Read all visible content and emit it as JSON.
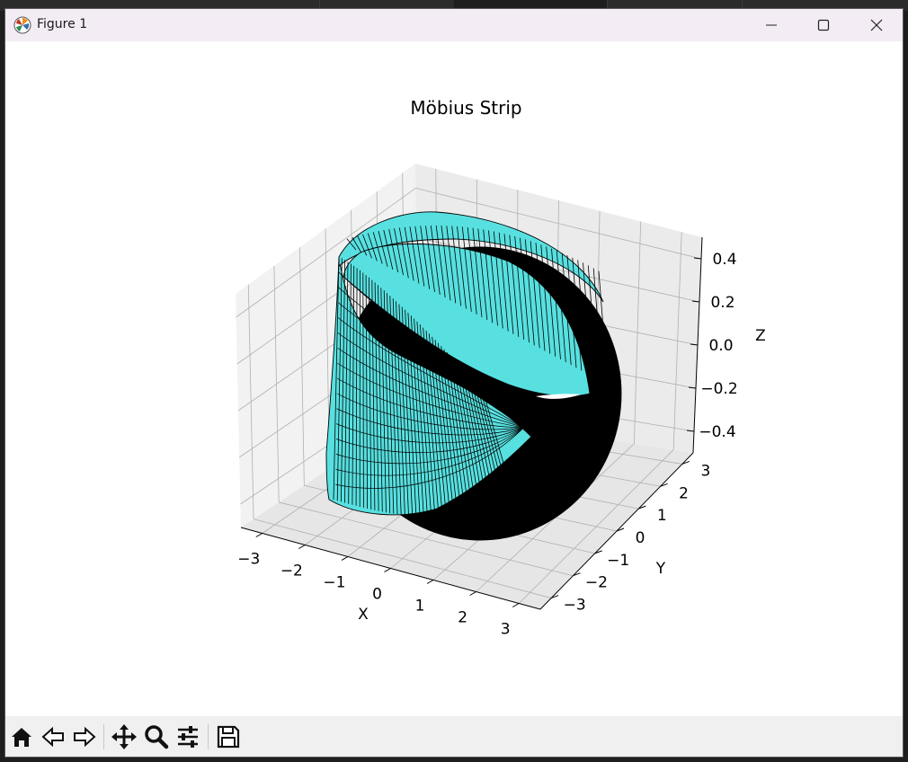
{
  "window": {
    "title": "Figure 1"
  },
  "colors": {
    "surface_face": "#58e0e0",
    "surface_edge": "#000000",
    "pane": "#f0f0f0",
    "titlebar": "#f3ecf4",
    "toolbar": "#f0f0f0"
  },
  "toolbar": {
    "icons": [
      "home-icon",
      "back-icon",
      "forward-icon",
      "pan-icon",
      "zoom-icon",
      "configure-subplots-icon",
      "save-icon"
    ]
  },
  "chart_data": {
    "type": "surface3d",
    "title": "Möbius Strip",
    "xlabel": "X",
    "ylabel": "Y",
    "zlabel": "Z",
    "xlim": [
      -3.5,
      3.5
    ],
    "ylim": [
      -3.5,
      3.5
    ],
    "zlim": [
      -0.5,
      0.5
    ],
    "x_ticks": [
      "−3",
      "−2",
      "−1",
      "0",
      "1",
      "2",
      "3"
    ],
    "y_ticks": [
      "−3",
      "−2",
      "−1",
      "0",
      "1",
      "2",
      "3"
    ],
    "z_ticks": [
      "−0.4",
      "−0.2",
      "0.0",
      "0.2",
      "0.4"
    ],
    "surface": {
      "equation": "x=(R+w*cos(t/2))*cos(t), y=(R+w*cos(t/2))*sin(t), z=w*sin(t/2)",
      "R": 3,
      "w_range": [
        -0.5,
        0.5
      ],
      "t_range": [
        0,
        6.283
      ]
    },
    "grid": true
  }
}
